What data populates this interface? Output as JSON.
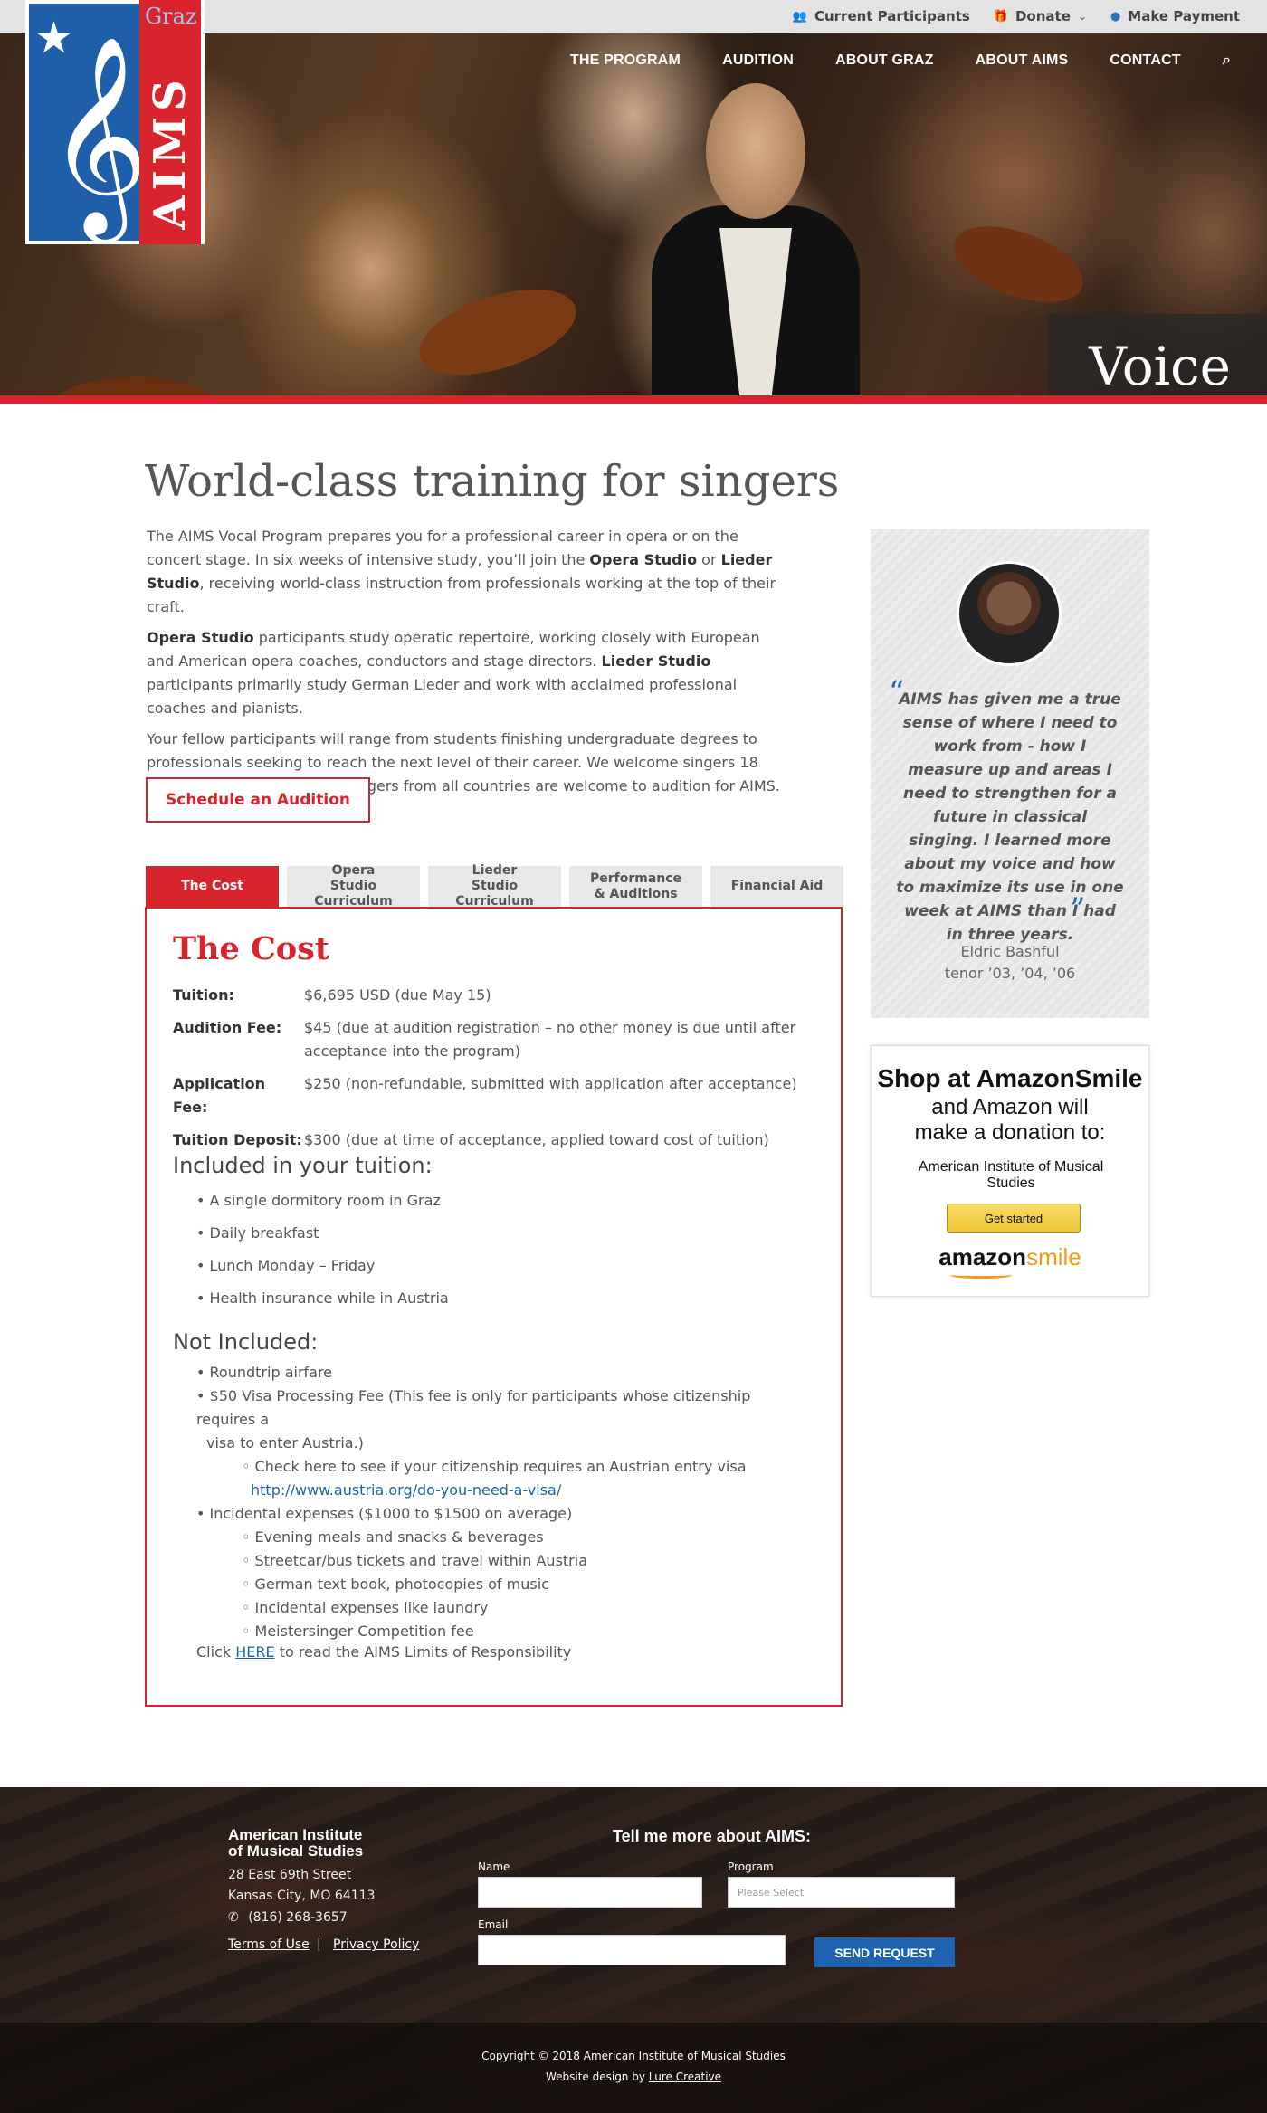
{
  "topbar": {
    "links": [
      {
        "icon": "users-icon",
        "glyph": "👥",
        "label": "Current Participants"
      },
      {
        "icon": "gift-icon",
        "glyph": "🎁",
        "label": "Donate",
        "caret": "⌄"
      },
      {
        "icon": "credit-card-icon",
        "glyph": "●",
        "label": "Make Payment"
      }
    ]
  },
  "logo": {
    "city": "Graz",
    "name": "AIMS"
  },
  "nav": {
    "items": [
      "THE PROGRAM",
      "AUDITION",
      "ABOUT GRAZ",
      "ABOUT AIMS",
      "CONTACT"
    ],
    "search_glyph": "⌕"
  },
  "hero": {
    "label": "Voice"
  },
  "main": {
    "title": "World-class training for singers",
    "intro": {
      "p1_a": "The AIMS Vocal Program prepares you for a professional career in opera or on the concert stage. In six weeks of intensive study, you’ll join the ",
      "p1_b1": "Opera Studio",
      "p1_or": " or ",
      "p1_b2": "Lieder Studio",
      "p1_c": ", receiving world-class instruction from professionals working at the top of their craft.",
      "p2_b1": "Opera Studio",
      "p2_a": " participants study operatic repertoire, working closely with European and American opera coaches, conductors and stage directors. ",
      "p2_b2": "Lieder Studio",
      "p2_c": " participants primarily study German Lieder and work with acclaimed professional coaches and pianists.",
      "p3": "Your fellow participants will range from students finishing undergraduate degrees to professionals seeking to reach the next level of their career. We welcome singers 18 years of age and older and singers from all countries are welcome to audition for AIMS."
    },
    "audition_button": "Schedule an Audition",
    "tabs": [
      {
        "label": "The Cost",
        "active": true
      },
      {
        "label": "Opera Studio Curriculum",
        "active": false
      },
      {
        "label": "Lieder Studio Curriculum",
        "active": false
      },
      {
        "label": "Performance & Auditions",
        "active": false
      },
      {
        "label": "Financial Aid",
        "active": false
      }
    ],
    "cost": {
      "title": "The Cost",
      "fees": [
        {
          "label": "Tuition:",
          "value": "$6,695 USD (due May 15)"
        },
        {
          "label": "Audition Fee:",
          "value": "$45 (due at audition registration – no other money is due until after acceptance into the program)"
        },
        {
          "label": "Application Fee:",
          "value": "$250 (non-refundable, submitted with application after acceptance)"
        },
        {
          "label": "Tuition Deposit:",
          "value": "$300 (due at time of acceptance, applied toward cost of tuition)"
        }
      ],
      "included_title": "Included in your tuition:",
      "included": [
        "• A single dormitory room in Graz",
        "• Daily breakfast",
        "• Lunch Monday – Friday",
        "• Health insurance while in Austria"
      ],
      "not_included_title": "Not Included:",
      "not_included": {
        "item1": "• Roundtrip airfare",
        "item2_a": "• $50 Visa Processing Fee (This fee is only for participants whose citizenship requires a",
        "item2_b": "visa to enter Austria.)",
        "sub1": "◦ Check here to see if your citizenship requires an Austrian entry visa",
        "sub1_link": "http://www.austria.org/do-you-need-a-visa/",
        "item3": "• Incidental expenses ($1000 to $1500 on average)",
        "subs": [
          "◦ Evening meals and snacks & beverages",
          "◦ Streetcar/bus tickets and travel within Austria",
          "◦ German text book, photocopies of music",
          "◦ Incidental expenses like laundry",
          "◦ Meistersinger Competition fee"
        ]
      },
      "click_a": "Click ",
      "click_link": "HERE",
      "click_b": " to read the AIMS Limits of Responsibility"
    }
  },
  "testimonial": {
    "open_quote": "“",
    "close_quote": "”",
    "quote": "AIMS has given me a true sense of where I need to work from - how I measure up and areas I need to strengthen for a future in classical singing.  I learned more about my voice and how to maximize its use in one week at AIMS than I had in three years.",
    "name": "Eldric Bashful",
    "role": "tenor ’03, ’04, ’06"
  },
  "amazon": {
    "headline": "Shop at AmazonSmile",
    "sub": "and Amazon will make a donation to:",
    "org": "American Institute of Musical Studies",
    "button": "Get started",
    "logo_a": "amazon",
    "logo_b": "smile"
  },
  "footer": {
    "org_line1": "American Institute",
    "org_line2": "of Musical Studies",
    "addr1": "28 East 69th Street",
    "addr2": "Kansas City, MO 64113",
    "phone_glyph": "✆",
    "phone": "(816) 268-3657",
    "terms": "Terms of Use",
    "sep": "|",
    "privacy": "Privacy Policy",
    "form_title": "Tell me more about AIMS:",
    "name_label": "Name",
    "program_label": "Program",
    "program_placeholder": "Please Select",
    "email_label": "Email",
    "send": "SEND REQUEST",
    "copyright": "Copyright © 2018 American Institute of Musical Studies",
    "design_a": "Website design by ",
    "design_link": "Lure Creative"
  }
}
